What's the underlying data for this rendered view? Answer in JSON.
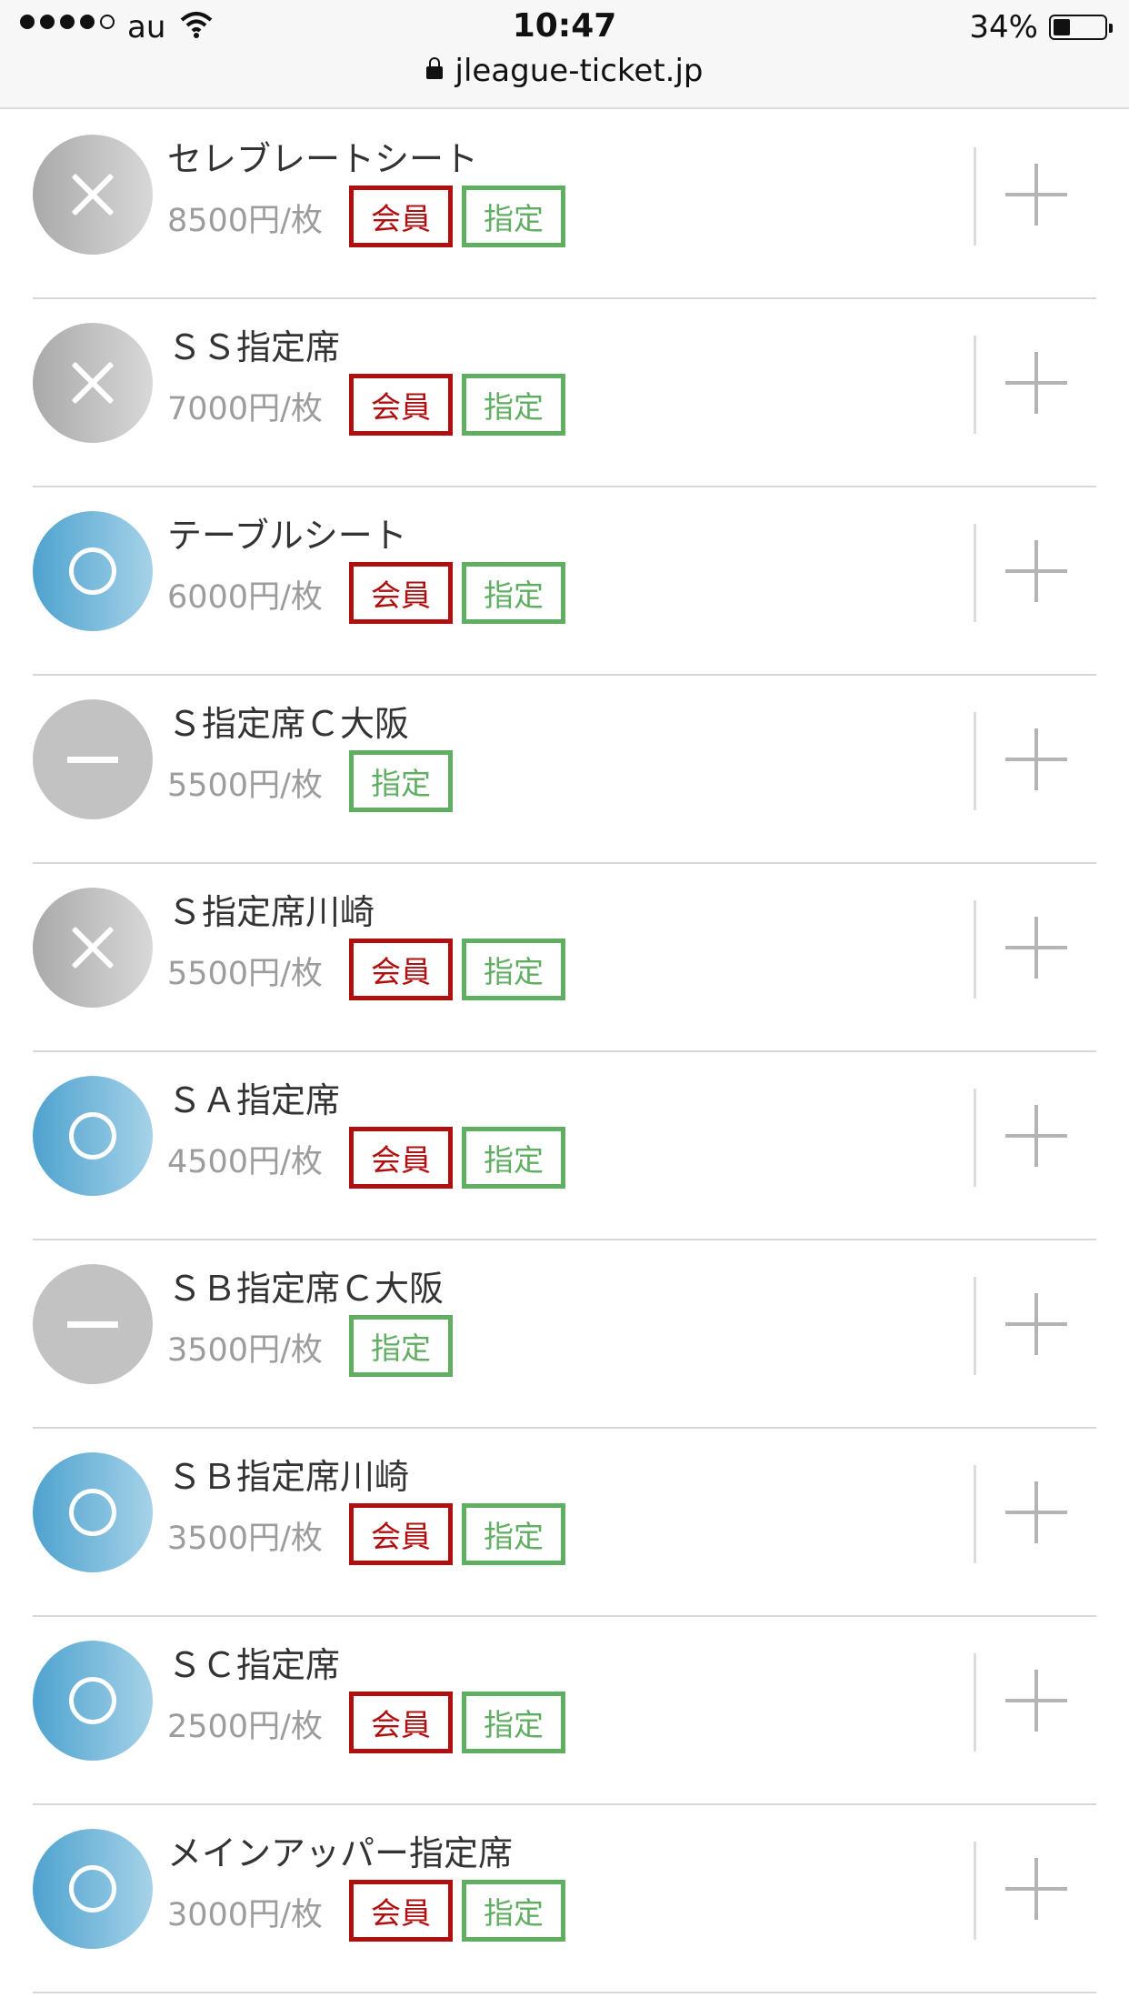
{
  "status_bar": {
    "carrier": "au",
    "time": "10:47",
    "battery_percent": "34%",
    "battery_level": 0.34,
    "url": "jleague-ticket.jp"
  },
  "colors": {
    "available": "#4ea2cf",
    "member_tag": "#b00f10",
    "reserved_tag": "#5fae62"
  },
  "seats": [
    {
      "name": "セレブレートシート",
      "price": "8500円/枚",
      "status": "soldout",
      "status_icon": "x-mark-icon",
      "tags": [
        "会員",
        "指定"
      ]
    },
    {
      "name": "ＳＳ指定席",
      "price": "7000円/枚",
      "status": "soldout",
      "status_icon": "x-mark-icon",
      "tags": [
        "会員",
        "指定"
      ]
    },
    {
      "name": "テーブルシート",
      "price": "6000円/枚",
      "status": "available",
      "status_icon": "circle-mark-icon",
      "tags": [
        "会員",
        "指定"
      ]
    },
    {
      "name": "Ｓ指定席Ｃ大阪",
      "price": "5500円/枚",
      "status": "na",
      "status_icon": "dash-mark-icon",
      "tags": [
        "指定"
      ]
    },
    {
      "name": "Ｓ指定席川崎",
      "price": "5500円/枚",
      "status": "soldout",
      "status_icon": "x-mark-icon",
      "tags": [
        "会員",
        "指定"
      ]
    },
    {
      "name": "ＳＡ指定席",
      "price": "4500円/枚",
      "status": "available",
      "status_icon": "circle-mark-icon",
      "tags": [
        "会員",
        "指定"
      ]
    },
    {
      "name": "ＳＢ指定席Ｃ大阪",
      "price": "3500円/枚",
      "status": "na",
      "status_icon": "dash-mark-icon",
      "tags": [
        "指定"
      ]
    },
    {
      "name": "ＳＢ指定席川崎",
      "price": "3500円/枚",
      "status": "available",
      "status_icon": "circle-mark-icon",
      "tags": [
        "会員",
        "指定"
      ]
    },
    {
      "name": "ＳＣ指定席",
      "price": "2500円/枚",
      "status": "available",
      "status_icon": "circle-mark-icon",
      "tags": [
        "会員",
        "指定"
      ]
    },
    {
      "name": "メインアッパー指定席",
      "price": "3000円/枚",
      "status": "available",
      "status_icon": "circle-mark-icon",
      "tags": [
        "会員",
        "指定"
      ]
    }
  ]
}
